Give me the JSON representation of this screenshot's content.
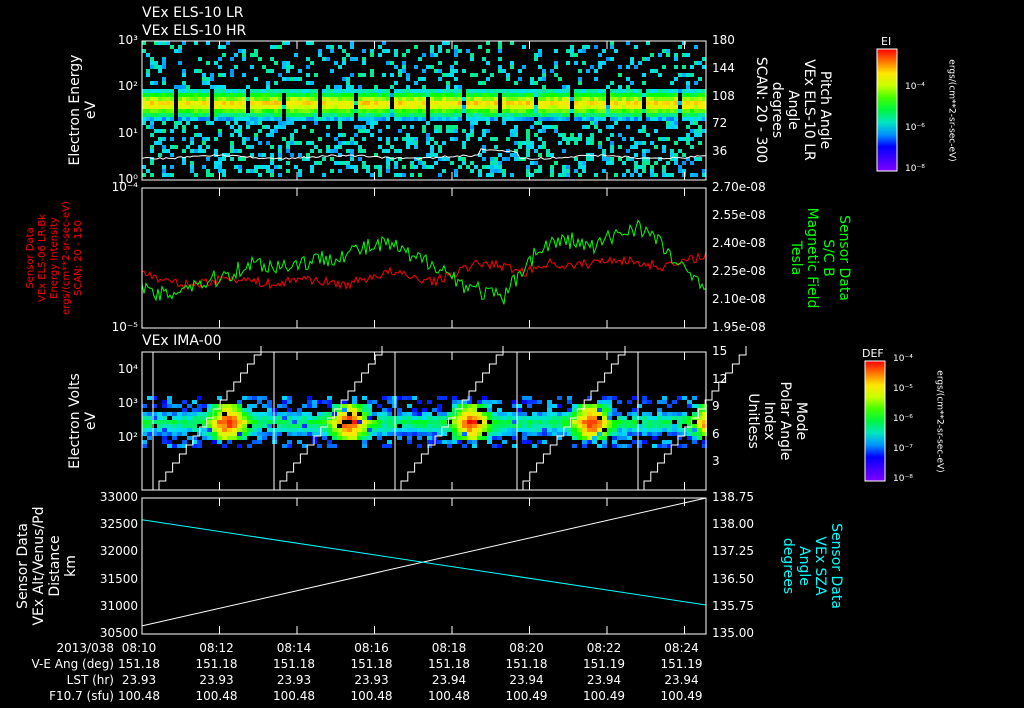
{
  "chart_data": [
    {
      "type": "heatmap",
      "title": [
        "VEx ELS-10 LR",
        "VEx ELS-10 HR"
      ],
      "ylabel": [
        "Electron Energy",
        "eV"
      ],
      "yticks": [
        "10⁰",
        "10¹",
        "10²",
        "10³"
      ],
      "ylim": [
        1,
        1000
      ],
      "y2label": [
        "Pitch Angle",
        "VEx ELS-10 LR",
        "Angle",
        "degrees",
        "SCAN: 20 - 300"
      ],
      "y2ticks": [
        "36",
        "72",
        "108",
        "144",
        "180"
      ],
      "y2lim": [
        0,
        180
      ],
      "colorbar": {
        "label": "EI",
        "unit": "ergs/(cm**2-sr-sec-eV)",
        "ticks": [
          "10⁻⁴",
          "10⁻⁶",
          "10⁻⁸"
        ]
      }
    },
    {
      "type": "line",
      "ylabel": [
        "Sensor Data",
        "VEx ELS-06 LR-Bk",
        "Energy Intensity",
        "ergs/(cm**2-sr-sec-eV)",
        "SCAN: 20 - 150"
      ],
      "yticks": [
        "10⁻⁵",
        "10⁻⁴"
      ],
      "ylim": [
        1e-05,
        0.0001
      ],
      "y2label": [
        "Sensor Data",
        "S/C B",
        "Magnetic Field",
        "Tesla"
      ],
      "y2ticks": [
        "1.95e-08",
        "2.10e-08",
        "2.25e-08",
        "2.40e-08",
        "2.55e-08",
        "2.70e-08"
      ],
      "y2lim": [
        1.95e-08,
        2.7e-08
      ],
      "series": [
        {
          "name": "Energy Intensity",
          "color": "#ff0000",
          "values": [
            2.25,
            2.2,
            2.18,
            2.2,
            2.22,
            2.2,
            2.18,
            2.22,
            2.2,
            2.18,
            2.22,
            2.25,
            2.22,
            2.2,
            2.25,
            2.3,
            2.28,
            2.25,
            2.3,
            2.28,
            2.3,
            2.32,
            2.3,
            2.28,
            2.3,
            2.35
          ]
        },
        {
          "name": "Magnetic Field",
          "color": "#00ff00",
          "values": [
            2.15,
            2.12,
            2.18,
            2.2,
            2.25,
            2.3,
            2.28,
            2.3,
            2.32,
            2.35,
            2.38,
            2.4,
            2.32,
            2.3,
            2.2,
            2.15,
            2.1,
            2.3,
            2.4,
            2.42,
            2.38,
            2.45,
            2.5,
            2.4,
            2.25,
            2.2
          ]
        }
      ]
    },
    {
      "type": "heatmap",
      "title": "VEx IMA-00",
      "ylabel": [
        "Electron Volts",
        "eV"
      ],
      "yticks": [
        "10²",
        "10³",
        "10⁴"
      ],
      "y2label": [
        "Mode",
        "Polar Angle",
        "Index",
        "Unitless"
      ],
      "y2ticks": [
        "3",
        "6",
        "9",
        "12",
        "15"
      ],
      "y2lim": [
        0,
        15
      ],
      "colorbar": {
        "label": "DEF",
        "unit": "ergs/(cm**2-sr-sec-eV)",
        "ticks": [
          "10⁻⁴",
          "10⁻⁵",
          "10⁻⁶",
          "10⁻⁷",
          "10⁻⁸"
        ]
      }
    },
    {
      "type": "line",
      "ylabel": [
        "Sensor Data",
        "VEx Alt/Venus/Pd",
        "Distance",
        "km"
      ],
      "yticks": [
        "30500",
        "31000",
        "31500",
        "32000",
        "32500",
        "33000"
      ],
      "ylim": [
        30500,
        33000
      ],
      "y2label": [
        "Sensor Data",
        "VEx SZA",
        "Angle",
        "degrees"
      ],
      "y2ticks": [
        "135.00",
        "135.75",
        "136.50",
        "137.25",
        "138.00",
        "138.75"
      ],
      "y2lim": [
        135,
        138.75
      ],
      "series": [
        {
          "name": "Distance",
          "color": "#ffffff",
          "x": [
            "08:10",
            "08:24.6"
          ],
          "values": [
            30650,
            33000
          ]
        },
        {
          "name": "SZA",
          "color": "#00ffff",
          "x": [
            "08:10",
            "08:24.6"
          ],
          "values": [
            138.15,
            135.8
          ]
        }
      ]
    }
  ],
  "table": {
    "date": "2013/038",
    "rows": [
      {
        "label": "V-E Ang (deg)",
        "values": [
          "151.18",
          "151.18",
          "151.18",
          "151.18",
          "151.18",
          "151.18",
          "151.19",
          "151.19"
        ]
      },
      {
        "label": "LST (hr)",
        "values": [
          "23.93",
          "23.93",
          "23.93",
          "23.93",
          "23.94",
          "23.94",
          "23.94",
          "23.94"
        ]
      },
      {
        "label": "F10.7 (sfu)",
        "values": [
          "100.48",
          "100.48",
          "100.48",
          "100.48",
          "100.48",
          "100.49",
          "100.49",
          "100.49"
        ]
      }
    ],
    "times": [
      "08:10",
      "08:12",
      "08:14",
      "08:16",
      "08:18",
      "08:20",
      "08:22",
      "08:24"
    ]
  }
}
